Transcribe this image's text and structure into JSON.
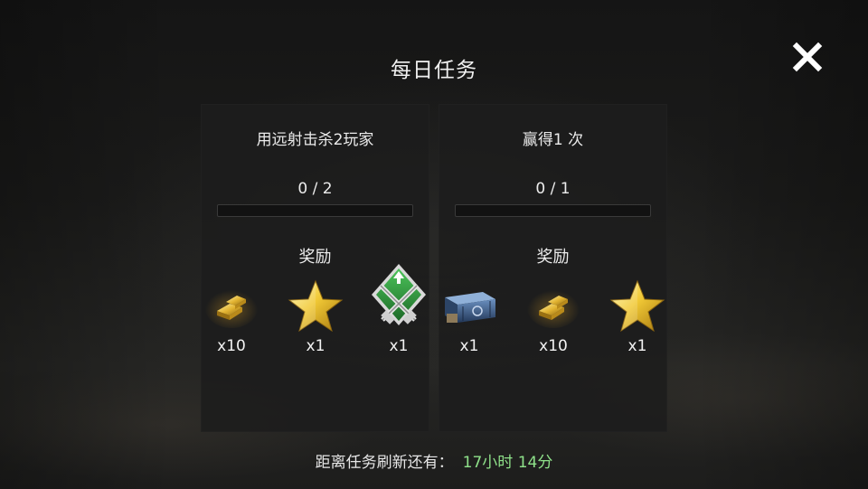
{
  "header": {
    "title": "每日任务",
    "close_icon": "close-icon"
  },
  "tasks": [
    {
      "name": "用远射击杀2玩家",
      "progress_text": "0 / 2",
      "progress_fraction": 0,
      "reward_label": "奖励",
      "rewards": [
        {
          "icon": "gold-bars-icon",
          "qty": "x10"
        },
        {
          "icon": "gold-star-icon",
          "qty": "x1"
        },
        {
          "icon": "crossed-rifles-badge-icon",
          "qty": "x1"
        }
      ]
    },
    {
      "name": "赢得1 次",
      "progress_text": "0 / 1",
      "progress_fraction": 0,
      "reward_label": "奖励",
      "rewards": [
        {
          "icon": "supply-crate-icon",
          "qty": "x1"
        },
        {
          "icon": "gold-bars-icon",
          "qty": "x10"
        },
        {
          "icon": "gold-star-icon",
          "qty": "x1"
        }
      ]
    }
  ],
  "footer": {
    "label": "距离任务刷新还有：",
    "timer": "17小时 14分"
  },
  "colors": {
    "timer": "#8fe28a",
    "gold": "#e8b830",
    "badge_green": "#2f8f3a",
    "crate_blue": "#3a5d8a"
  }
}
